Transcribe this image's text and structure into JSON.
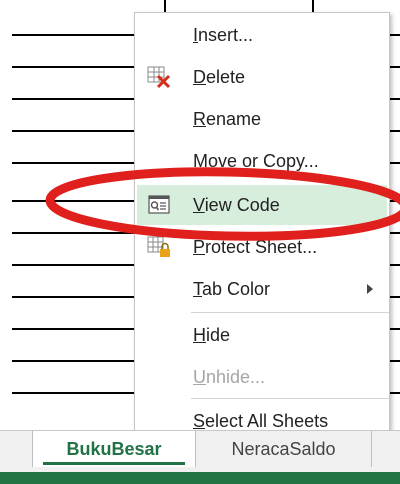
{
  "menu": {
    "items": [
      {
        "label": "Insert...",
        "mnemonic_index": 0,
        "icon": "",
        "state": "normal"
      },
      {
        "label": "Delete",
        "mnemonic_index": 0,
        "icon": "delete-sheet-icon",
        "state": "normal"
      },
      {
        "label": "Rename",
        "mnemonic_index": 0,
        "icon": "",
        "state": "normal"
      },
      {
        "label": "Move or Copy...",
        "mnemonic_index": 0,
        "icon": "",
        "state": "normal"
      },
      {
        "label": "View Code",
        "mnemonic_index": 0,
        "icon": "view-code-icon",
        "state": "highlighted"
      },
      {
        "label": "Protect Sheet...",
        "mnemonic_index": 0,
        "icon": "protect-sheet-icon",
        "state": "normal"
      },
      {
        "label": "Tab Color",
        "mnemonic_index": 0,
        "icon": "",
        "state": "submenu"
      },
      {
        "label": "Hide",
        "mnemonic_index": 0,
        "icon": "",
        "state": "normal"
      },
      {
        "label": "Unhide...",
        "mnemonic_index": 0,
        "icon": "",
        "state": "disabled"
      },
      {
        "label": "Select All Sheets",
        "mnemonic_index": 0,
        "icon": "",
        "state": "normal"
      }
    ],
    "highlight_color": "#d7eedc",
    "annotation_color": "#e0201c"
  },
  "tabs": [
    {
      "label": "BukuBesar",
      "active": true
    },
    {
      "label": "NeracaSaldo",
      "active": false
    }
  ],
  "colors": {
    "excel_green": "#217346"
  }
}
